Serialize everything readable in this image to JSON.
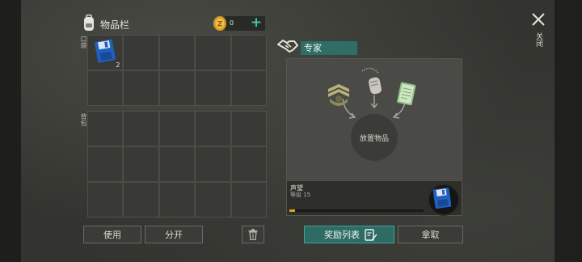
{
  "inventory": {
    "title": "物品栏",
    "coins": "0",
    "pocket_label": "口袋",
    "bag_label": "背包",
    "pocket_slots": [
      {
        "icon": "floppy-disk",
        "count": "2"
      },
      {},
      {},
      {},
      {},
      {},
      {},
      {},
      {},
      {}
    ],
    "bag_slots": [
      {},
      {},
      {},
      {},
      {},
      {},
      {},
      {},
      {},
      {},
      {},
      {},
      {},
      {},
      {}
    ]
  },
  "actions": {
    "use": "使用",
    "split": "分开"
  },
  "expert": {
    "title": "专家",
    "place_items": "放置物品",
    "reputation": {
      "label": "声望",
      "level": "等级 15",
      "progress": 0.04
    },
    "reward_list": "奖励列表",
    "take": "拿取"
  },
  "close_label": "关闭",
  "colors": {
    "accent_teal": "#2d6b64",
    "plus_teal": "#3fc7b0",
    "progress_orange": "#e0a21c",
    "disk_blue": "#1f5fbf"
  }
}
